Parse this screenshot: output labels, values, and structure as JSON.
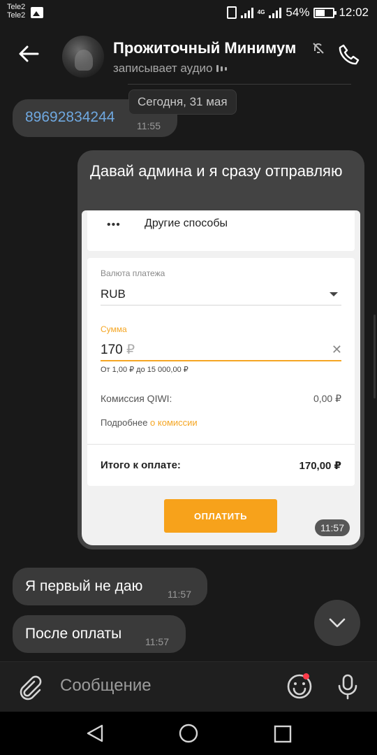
{
  "status_bar": {
    "carrier_1": "Tele2",
    "carrier_2": "Tele2",
    "battery": "54%",
    "time": "12:02",
    "network": "4G"
  },
  "header": {
    "title": "Прожиточный Минимум",
    "status": "записывает аудио"
  },
  "date_separator": "Сегодня, 31 мая",
  "messages": [
    {
      "text": "89692834244",
      "time": "11:55"
    },
    {
      "text": "Давай админа и я сразу отправляю",
      "time": "11:57"
    },
    {
      "text": "Я первый не даю",
      "time": "11:57"
    },
    {
      "text": "После оплаты",
      "time": "11:57"
    }
  ],
  "payment_screenshot": {
    "other_ways": "Другие способы",
    "currency_label": "Валюта платежа",
    "currency_value": "RUB",
    "amount_label": "Сумма",
    "amount_value": "170",
    "amount_currency": "₽",
    "amount_hint": "От 1,00 ₽ до 15 000,00 ₽",
    "fee_label": "Комиссия QIWI:",
    "fee_value": "0,00 ₽",
    "more_prefix": "Подробнее",
    "more_link": "о комиссии",
    "total_label": "Итого к оплате:",
    "total_value": "170,00 ₽",
    "pay_button": "ОПЛАТИТЬ"
  },
  "composer": {
    "placeholder": "Сообщение"
  },
  "colors": {
    "background": "#191919",
    "bubble": "#3a3a3a",
    "link": "#6fa8e0",
    "accent_orange": "#f7a21b",
    "notification_dot": "#ff3b4a"
  },
  "icons": {
    "back": "arrow-left-icon",
    "mute": "muted-bell-icon",
    "call": "phone-icon",
    "attach": "paperclip-icon",
    "emoji": "smiley-icon",
    "mic": "microphone-icon",
    "scroll_down": "chevron-down-icon"
  }
}
